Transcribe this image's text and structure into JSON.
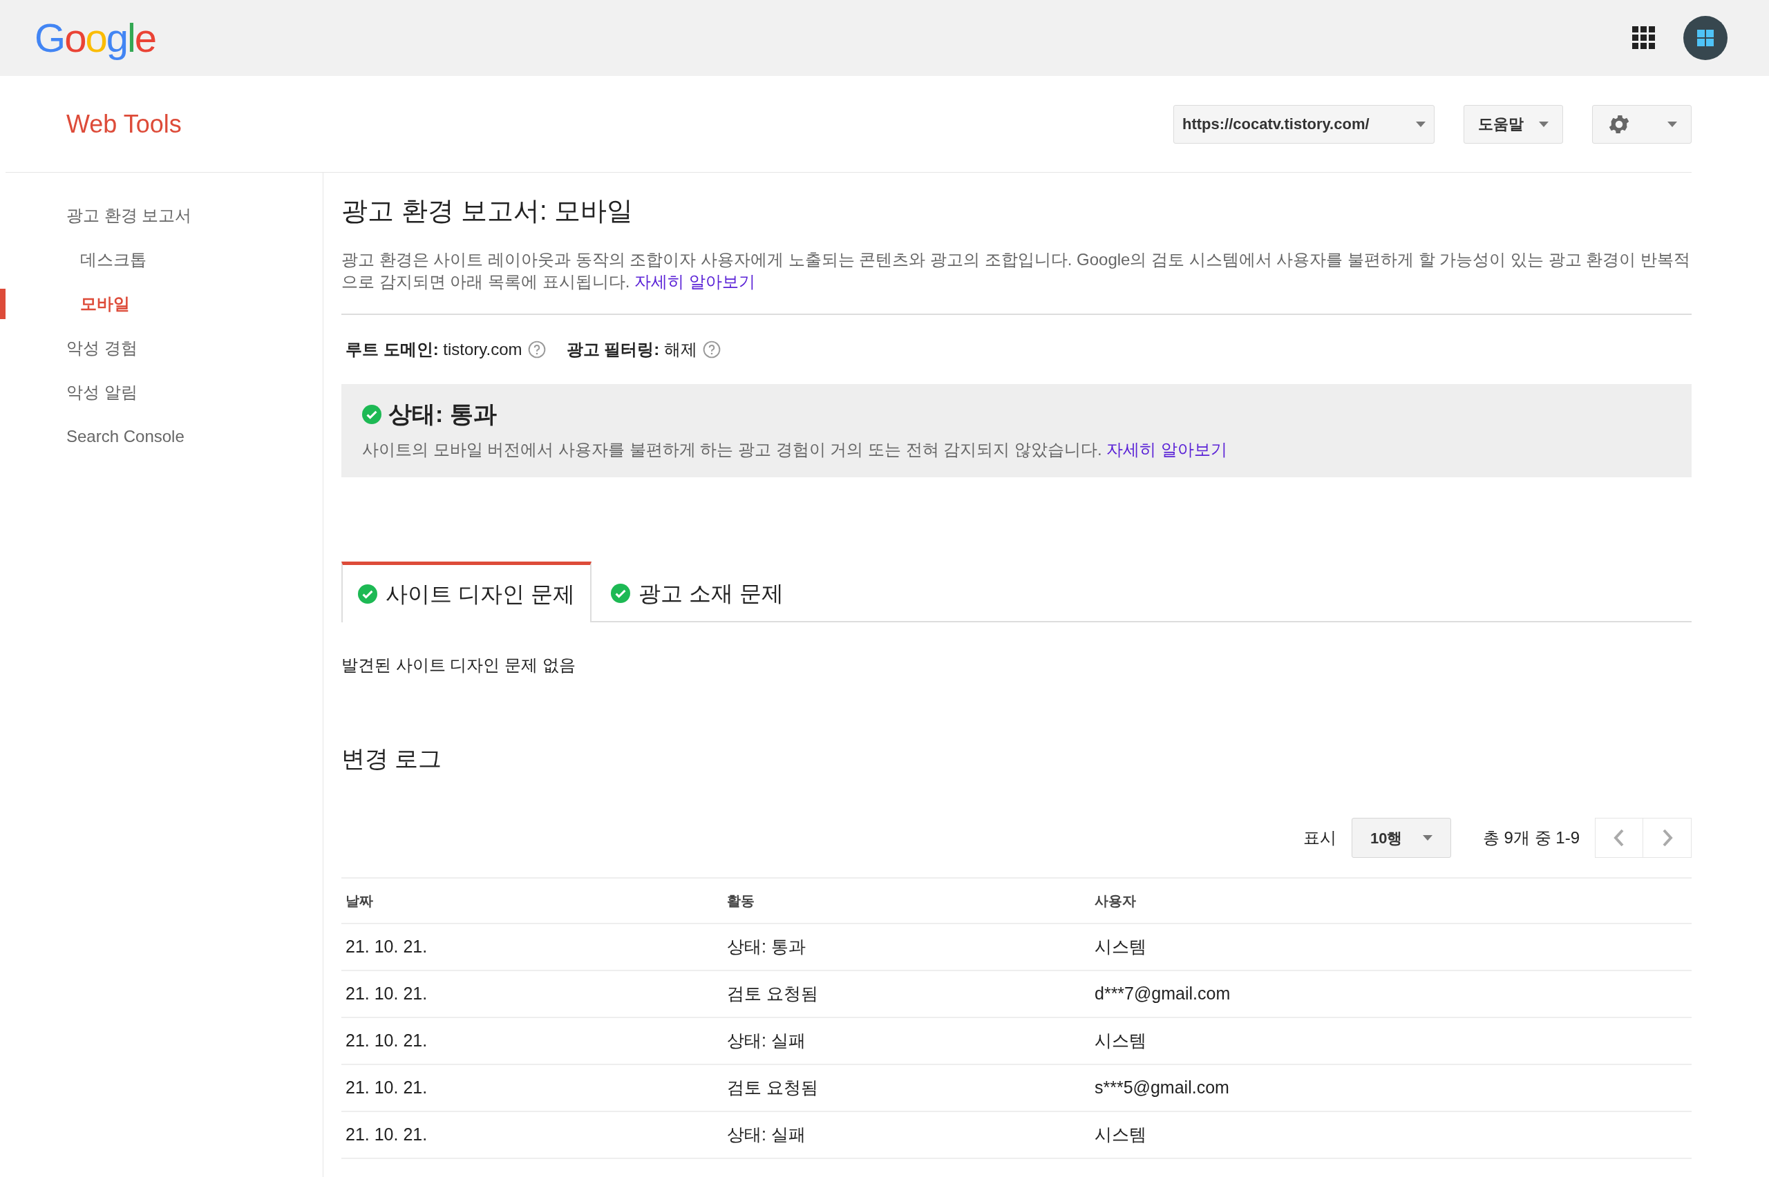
{
  "topbar": {
    "logo": "Google"
  },
  "header": {
    "title": "Web Tools",
    "site_select": "https://cocatv.tistory.com/",
    "help_select": "도움말"
  },
  "sidebar": {
    "items": [
      {
        "label": "광고 환경 보고서",
        "selected": false,
        "children": [
          {
            "label": "데스크톱",
            "selected": false
          },
          {
            "label": "모바일",
            "selected": true
          }
        ]
      },
      {
        "label": "악성 경험",
        "selected": false
      },
      {
        "label": "악성 알림",
        "selected": false
      },
      {
        "label": "Search Console",
        "selected": false
      }
    ]
  },
  "main": {
    "title": "광고 환경 보고서: 모바일",
    "description": "광고 환경은 사이트 레이아웃과 동작의 조합이자 사용자에게 노출되는 콘텐츠와 광고의 조합입니다. Google의 검토 시스템에서 사용자를 불편하게 할 가능성이 있는 광고 환경이 반복적으로 감지되면 아래 목록에 표시됩니다.",
    "description_link": "자세히 알아보기",
    "meta": [
      {
        "label": "루트 도메인:",
        "value": "tistory.com"
      },
      {
        "label": "광고 필터링:",
        "value": "해제"
      }
    ],
    "status": {
      "title": "상태: 통과",
      "passed": true,
      "text": "사이트의 모바일 버전에서 사용자를 불편하게 하는 광고 경험이 거의 또는 전혀 감지되지 않았습니다.",
      "link": "자세히 알아보기"
    },
    "tabs": [
      {
        "label": "사이트 디자인 문제",
        "selected": true
      },
      {
        "label": "광고 소재 문제",
        "selected": false
      }
    ],
    "tab_message": "발견된 사이트 디자인 문제 없음"
  },
  "change_log": {
    "title": "변경 로그",
    "rows_label": "표시",
    "rows_select": "10행",
    "range": "총 9개 중 1-9",
    "columns": [
      "날짜",
      "활동",
      "사용자"
    ],
    "rows": [
      [
        "21. 10. 21.",
        "상태: 통과",
        "시스템"
      ],
      [
        "21. 10. 21.",
        "검토 요청됨",
        "d***7@gmail.com"
      ],
      [
        "21. 10. 21.",
        "상태: 실패",
        "시스템"
      ],
      [
        "21. 10. 21.",
        "검토 요청됨",
        "s***5@gmail.com"
      ],
      [
        "21. 10. 21.",
        "상태: 실패",
        "시스템"
      ]
    ]
  }
}
